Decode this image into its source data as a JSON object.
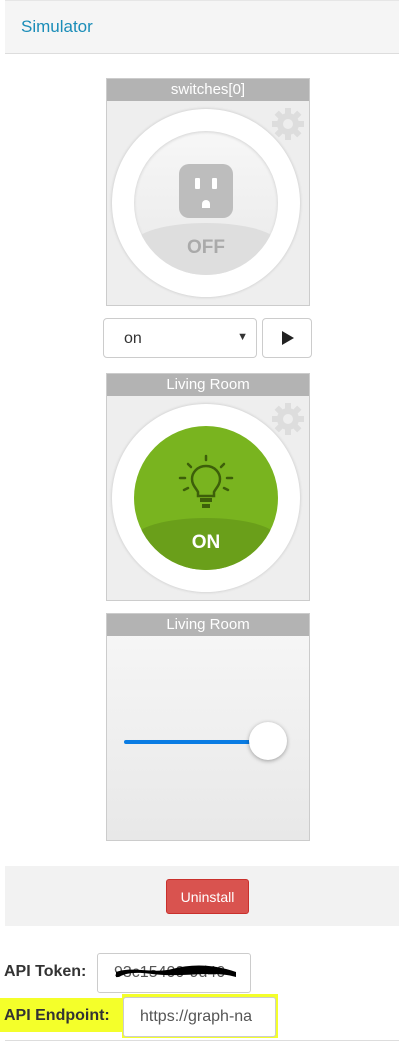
{
  "header": {
    "title": "Simulator"
  },
  "tiles": [
    {
      "title": "switches[0]",
      "state": "OFF"
    },
    {
      "title": "Living Room",
      "state": "ON"
    },
    {
      "title": "Living Room",
      "slider_level": 1.0
    }
  ],
  "controls": {
    "select_value": "on"
  },
  "footer": {
    "uninstall_label": "Uninstall"
  },
  "settings": {
    "api_token_label": "API Token:",
    "api_token_value": "93c15400-9d40",
    "api_endpoint_label": "API Endpoint:",
    "api_endpoint_value": "https://graph-na"
  },
  "colors": {
    "accent": "#1a8db8",
    "on_green": "#79b41f",
    "danger": "#d9534f",
    "slider_blue": "#0a7ce3",
    "highlight": "#f4ff2a"
  },
  "icons": [
    "gear-icon",
    "outlet-icon",
    "lightbulb-icon",
    "play-icon",
    "caret-down-icon"
  ]
}
